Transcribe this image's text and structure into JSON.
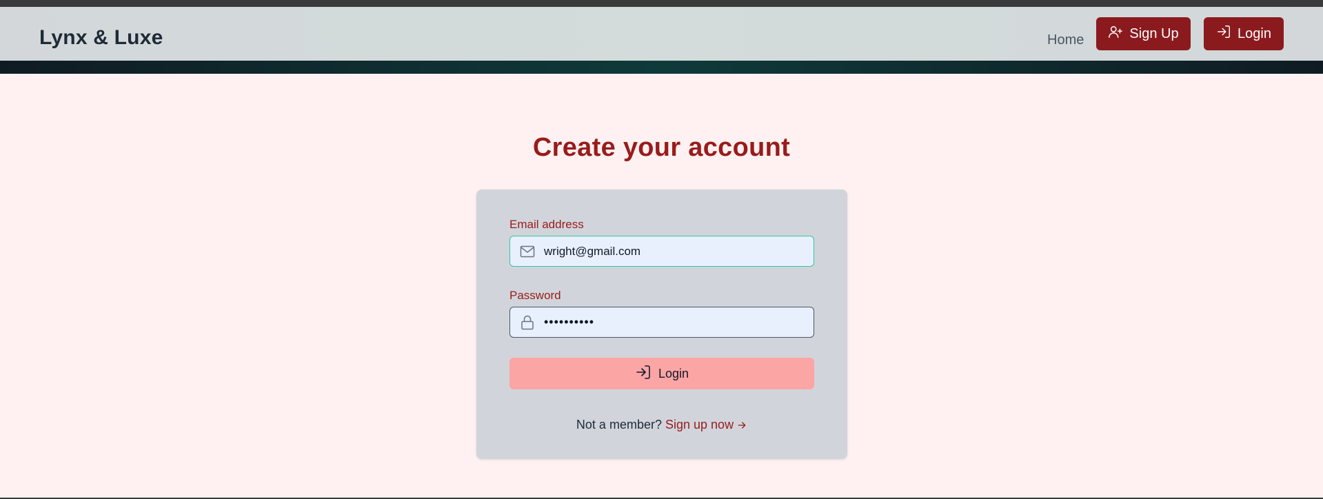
{
  "app": {
    "brand": "Lynx & Luxe"
  },
  "nav": {
    "home_label": "Home",
    "signup_label": "Sign Up",
    "login_label": "Login",
    "accent_color": "#8b1a1f"
  },
  "page": {
    "title": "Create your account"
  },
  "form": {
    "email": {
      "label": "Email address",
      "value": "wright@gmail.com",
      "icon": "mail-icon"
    },
    "password": {
      "label": "Password",
      "value": "••••••••••",
      "icon": "lock-icon"
    },
    "submit_label": "Login",
    "footer_prefix": "Not a member?",
    "footer_link": "Sign up now"
  }
}
